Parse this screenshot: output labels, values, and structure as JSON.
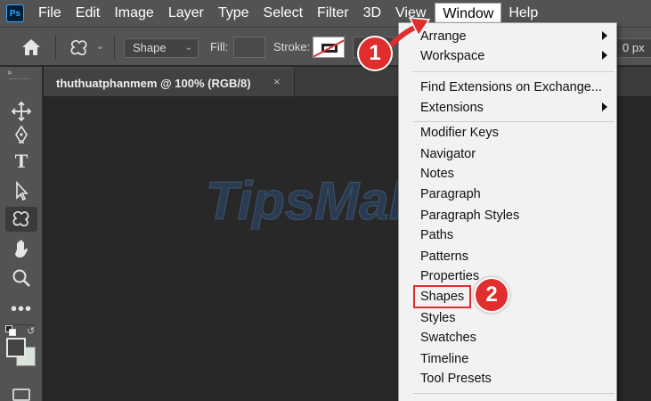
{
  "app": {
    "logo_text": "Ps"
  },
  "menubar": {
    "items": [
      "File",
      "Edit",
      "Image",
      "Layer",
      "Type",
      "Select",
      "Filter",
      "3D",
      "View",
      "Window",
      "Help"
    ],
    "active": "Window"
  },
  "options": {
    "mode_value": "Shape",
    "fill_label": "Fill:",
    "stroke_label": "Stroke:",
    "width_value": "0 px"
  },
  "document": {
    "tab_title": "thuthuatphanmem @ 100% (RGB/8)",
    "close_glyph": "×"
  },
  "watermark": {
    "text": "TipsMake"
  },
  "window_menu": {
    "items": [
      {
        "label": "Arrange",
        "submenu": true
      },
      {
        "label": "Workspace",
        "submenu": true
      },
      {
        "label": "Find Extensions on Exchange...",
        "submenu": false
      },
      {
        "label": "Extensions",
        "submenu": true
      },
      {
        "label": "Modifier Keys",
        "submenu": false
      },
      {
        "label": "Navigator",
        "submenu": false
      },
      {
        "label": "Notes",
        "submenu": false
      },
      {
        "label": "Paragraph",
        "submenu": false
      },
      {
        "label": "Paragraph Styles",
        "submenu": false
      },
      {
        "label": "Paths",
        "submenu": false
      },
      {
        "label": "Patterns",
        "submenu": false
      },
      {
        "label": "Properties",
        "submenu": false
      },
      {
        "label": "Shapes",
        "submenu": false,
        "highlighted": true
      },
      {
        "label": "Styles",
        "submenu": false
      },
      {
        "label": "Swatches",
        "submenu": false
      },
      {
        "label": "Timeline",
        "submenu": false
      },
      {
        "label": "Tool Presets",
        "submenu": false
      }
    ]
  },
  "annotations": {
    "step1": "1",
    "step2": "2"
  },
  "colors": {
    "accent": "#e02d2d",
    "menu_bg": "#f2f2f2",
    "ui_bg": "#535353",
    "canvas_bg": "#282828"
  }
}
